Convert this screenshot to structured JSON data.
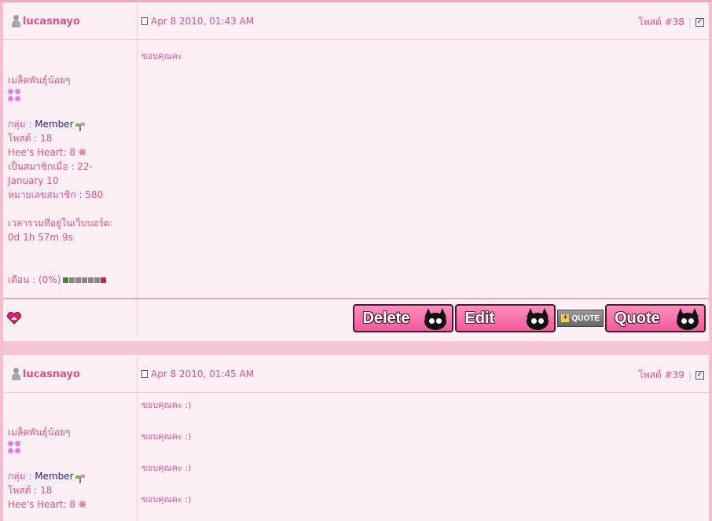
{
  "posts": [
    {
      "author": "lucasnayo",
      "date": "Apr 8 2010, 01:43 AM",
      "post_number": "โพสต์ #38",
      "nickname": "เมล็ดพันธุ์น้อยๆ",
      "group_label": "กลุ่ม : ",
      "group_value": "Member",
      "posts_count": "โพสต์ : 18",
      "hearts": "Hee's Heart: 8 ❋",
      "joined": "เป็นสมาชิกเมื่อ : 22-January 10",
      "member_no": "หมายเลขสมาชิก : 580",
      "online_label": "เวลารวมที่อยู่ในเว็บบอร์ด:",
      "online_value": "0d 1h 57m 9s",
      "warn": "เตือน : (0%)",
      "content": [
        "ขอบคุณคะ"
      ]
    },
    {
      "author": "lucasnayo",
      "date": "Apr 8 2010, 01:45 AM",
      "post_number": "โพสต์ #39",
      "nickname": "เมล็ดพันธุ์น้อยๆ",
      "group_label": "กลุ่ม : ",
      "group_value": "Member",
      "posts_count": "โพสต์ : 18",
      "hearts": "Hee's Heart: 8 ❋",
      "content": [
        "ขอบคุณคะ :)",
        "ขอบคุณคะ :)",
        "ขอบคุณคะ :)",
        "ขอบคุณคะ :)"
      ]
    }
  ],
  "buttons": {
    "delete": "Delete",
    "edit": "Edit",
    "multiquote": "QUOTE",
    "quote": "Quote"
  }
}
